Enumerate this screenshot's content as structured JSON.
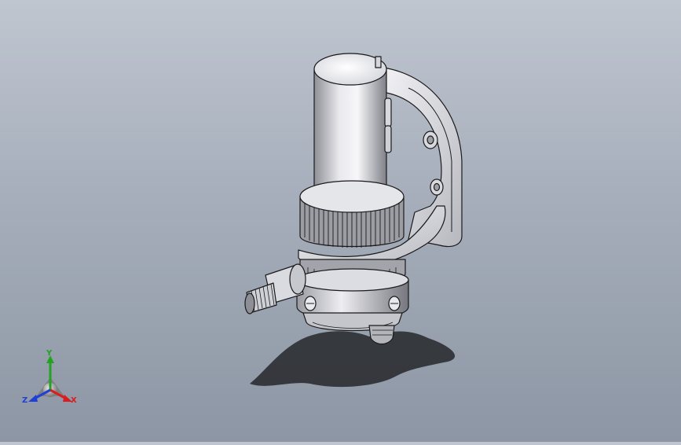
{
  "viewport": {
    "background_top": "#bfc6d0",
    "background_bottom": "#8d96a4"
  },
  "model": {
    "shadow_color": "#2b2d31",
    "metal_light": "#f4f4f7",
    "metal_mid": "#c9cad0",
    "metal_dark": "#6c6e76",
    "edge_color": "#1a1a1a"
  },
  "triad": {
    "x_label": "X",
    "y_label": "Y",
    "z_label": "Z",
    "x_color": "#d81e1e",
    "y_color": "#23a323",
    "z_color": "#1f3fd6"
  }
}
